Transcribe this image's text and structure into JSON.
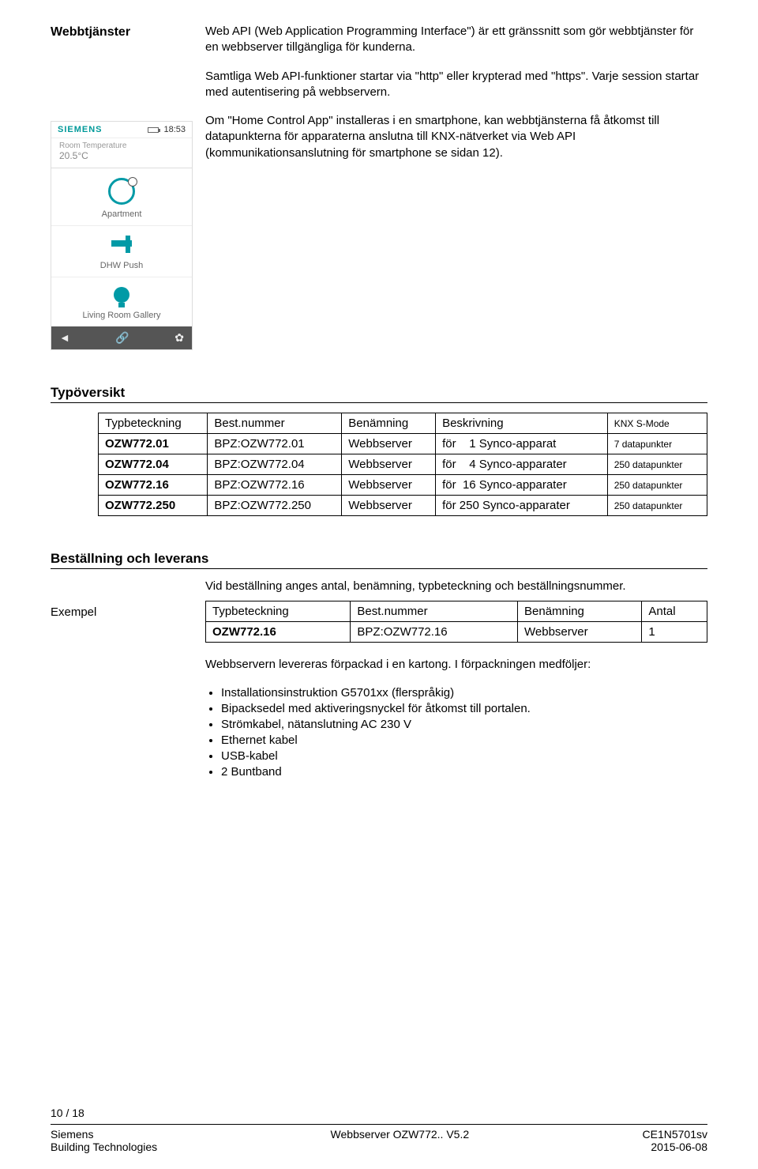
{
  "sidelabel_web": "Webbtjänster",
  "intro_para1": "Web API (Web Application Programming Interface\") är ett gränssnitt som gör webbtjänster för en webbserver tillgängliga för kunderna.",
  "intro_para2": "Samtliga Web API-funktioner startar via \"http\" eller krypterad med \"https\". Varje session startar med autentisering på webbservern.",
  "intro_para3": "Om \"Home Control App\" installeras i en smartphone, kan webbtjänsterna få åtkomst till datapunkterna för apparaterna anslutna till KNX-nätverket via Web API (kommunikationsanslutning för smartphone se sidan 12).",
  "phone": {
    "brand": "SIEMENS",
    "time": "18:53",
    "temp_label": "Room Temperature",
    "temp_value": "20.5°C",
    "item1": "Apartment",
    "item2": "DHW Push",
    "item3": "Living Room Gallery",
    "nav_left": "◄",
    "nav_mid": "🔗",
    "nav_right": "✿"
  },
  "type_heading": "Typöversikt",
  "type_table": {
    "headers": {
      "c1": "Typbeteckning",
      "c2": "Best.nummer",
      "c3": "Benämning",
      "c4": "Beskrivning",
      "c5": "KNX S-Mode"
    },
    "rows": [
      {
        "c1": "OZW772.01",
        "c2": "BPZ:OZW772.01",
        "c3": "Webbserver",
        "c4a": "för",
        "c4b": "1 Synco-apparat",
        "c5": "7 datapunkter"
      },
      {
        "c1": "OZW772.04",
        "c2": "BPZ:OZW772.04",
        "c3": "Webbserver",
        "c4a": "för",
        "c4b": "4 Synco-apparater",
        "c5": "250 datapunkter"
      },
      {
        "c1": "OZW772.16",
        "c2": "BPZ:OZW772.16",
        "c3": "Webbserver",
        "c4a": "för",
        "c4b": "16 Synco-apparater",
        "c5": "250 datapunkter"
      },
      {
        "c1": "OZW772.250",
        "c2": "BPZ:OZW772.250",
        "c3": "Webbserver",
        "c4a": "för",
        "c4b": "250 Synco-apparater",
        "c5": "250 datapunkter"
      }
    ]
  },
  "order_heading": "Beställning och leverans",
  "order_intro": "Vid beställning anges antal, benämning, typbeteckning och beställningsnummer.",
  "order_example_label": "Exempel",
  "order_table": {
    "headers": {
      "c1": "Typbeteckning",
      "c2": "Best.nummer",
      "c3": "Benämning",
      "c4": "Antal"
    },
    "row": {
      "c1": "OZW772.16",
      "c2": "BPZ:OZW772.16",
      "c3": "Webbserver",
      "c4": "1"
    }
  },
  "delivery_para": "Webbservern levereras förpackad i en kartong. I förpackningen medföljer:",
  "delivery_items": [
    "Installationsinstruktion G5701xx (flerspråkig)",
    "Bipacksedel med aktiveringsnyckel för åtkomst till portalen.",
    "Strömkabel, nätanslutning AC 230 V",
    "Ethernet kabel",
    "USB-kabel",
    "2 Buntband"
  ],
  "footer": {
    "page": "10 / 18",
    "left1": "Siemens",
    "left2": "Building Technologies",
    "center": "Webbserver OZW772.. V5.2",
    "right1": "CE1N5701sv",
    "right2": "2015-06-08"
  }
}
